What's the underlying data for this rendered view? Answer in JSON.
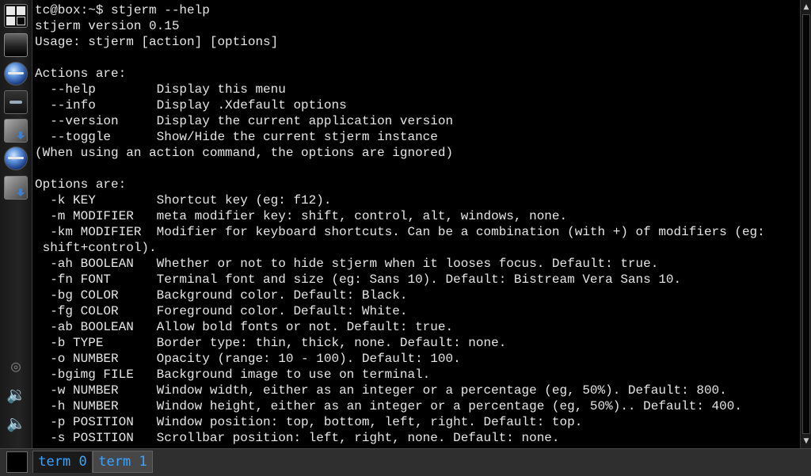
{
  "dock": {
    "icons": [
      "menu-icon",
      "terminal-icon",
      "browser-icon",
      "control-panel-icon",
      "app-install-icon",
      "browser-icon",
      "app-install-icon",
      "network-icon",
      "volume-up-icon",
      "volume-down-icon"
    ]
  },
  "terminal": {
    "lines": [
      "tc@box:~$ stjerm --help",
      "stjerm version 0.15",
      "Usage: stjerm [action] [options]",
      "",
      "Actions are:",
      "  --help        Display this menu",
      "  --info        Display .Xdefault options",
      "  --version     Display the current application version",
      "  --toggle      Show/Hide the current stjerm instance",
      "(When using an action command, the options are ignored)",
      "",
      "Options are:",
      "  -k KEY        Shortcut key (eg: f12).",
      "  -m MODIFIER   meta modifier key: shift, control, alt, windows, none.",
      "  -km MODIFIER  Modifier for keyboard shortcuts. Can be a combination (with +) of modifiers (eg:",
      " shift+control).",
      "  -ah BOOLEAN   Whether or not to hide stjerm when it looses focus. Default: true.",
      "  -fn FONT      Terminal font and size (eg: Sans 10). Default: Bistream Vera Sans 10.",
      "  -bg COLOR     Background color. Default: Black.",
      "  -fg COLOR     Foreground color. Default: White.",
      "  -ab BOOLEAN   Allow bold fonts or not. Default: true.",
      "  -b TYPE       Border type: thin, thick, none. Default: none.",
      "  -o NUMBER     Opacity (range: 10 - 100). Default: 100.",
      "  -bgimg FILE   Background image to use on terminal.",
      "  -w NUMBER     Window width, either as an integer or a percentage (eg, 50%). Default: 800.",
      "  -h NUMBER     Window height, either as an integer or a percentage (eg, 50%).. Default: 400.",
      "  -p POSITION   Window position: top, bottom, left, right. Default: top.",
      "  -s POSITION   Scrollbar position: left, right, none. Default: none."
    ]
  },
  "scrollbar": {
    "up": "▲",
    "down": "▼"
  },
  "tabs": [
    {
      "label": "term 0"
    },
    {
      "label": "term 1"
    }
  ],
  "colors": {
    "background": "#000000",
    "text": "#e6e6e6",
    "tab_label": "#3da3ff"
  }
}
